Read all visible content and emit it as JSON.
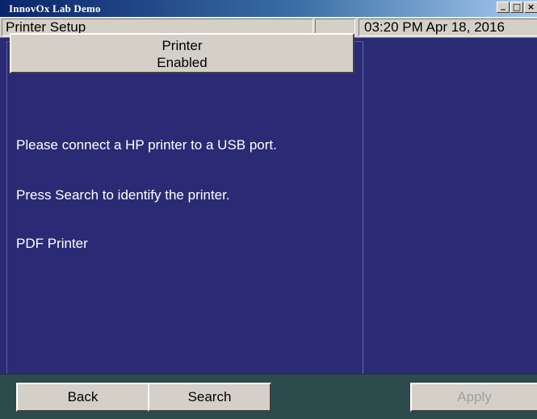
{
  "window": {
    "title": "InnovOx Lab Demo",
    "controls": {
      "minimize": "_",
      "maximize": "□",
      "close": "×"
    }
  },
  "status_bar": {
    "screen_title": "Printer Setup",
    "middle_cell": "",
    "datetime": "03:20 PM Apr 18, 2016"
  },
  "printer": {
    "line1": "Printer",
    "line2": "Enabled"
  },
  "messages": {
    "connect": "Please connect a HP printer to a USB port.",
    "search": "Press Search to identify the printer.",
    "printer_name": "PDF Printer"
  },
  "buttons": {
    "back": "Back",
    "search": "Search",
    "apply": "Apply"
  },
  "colors": {
    "panel_bg": "#2b2a74",
    "bottom_bar": "#2d4a4d",
    "button_face": "#d4d0c8",
    "title_bar": "#0a246a"
  }
}
